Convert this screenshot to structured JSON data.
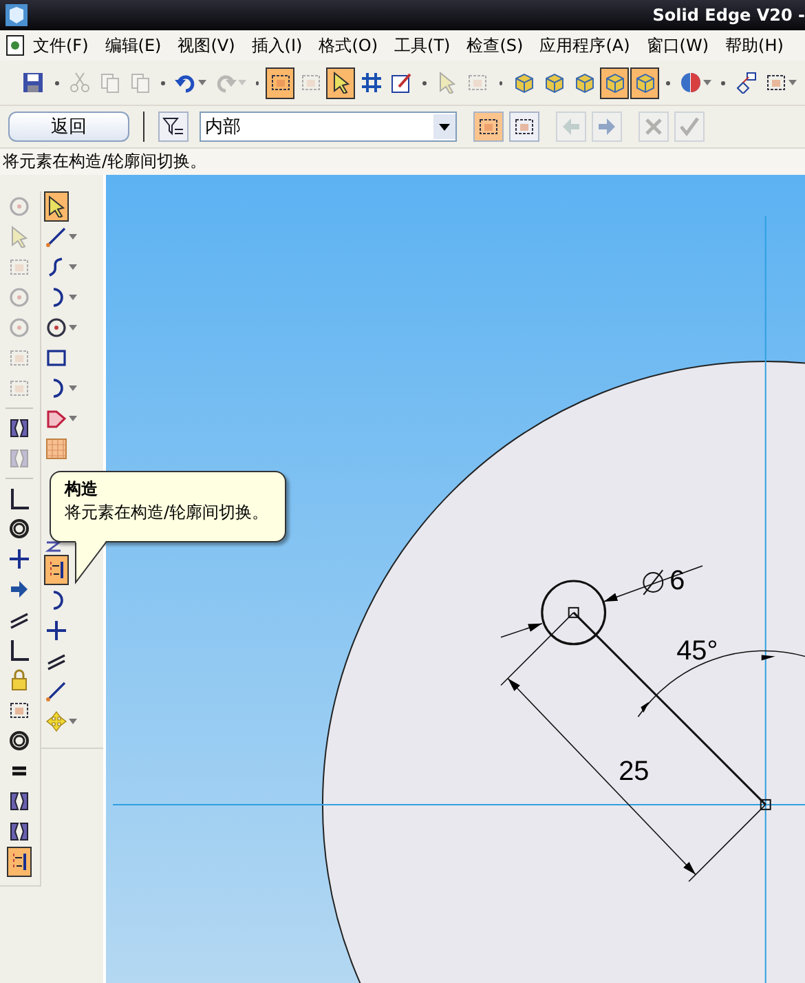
{
  "window": {
    "title": "Solid Edge V20 - "
  },
  "menu": [
    "文件(F)",
    "编辑(E)",
    "视图(V)",
    "插入(I)",
    "格式(O)",
    "工具(T)",
    "检查(S)",
    "应用程序(A)",
    "窗口(W)",
    "帮助(H)"
  ],
  "toolbar": [
    [
      {
        "kind": "save",
        "selected": false,
        "disabled": false,
        "dropdown": false
      }
    ],
    [
      {
        "kind": "cut",
        "selected": false,
        "disabled": true,
        "dropdown": false
      },
      {
        "kind": "copy",
        "selected": false,
        "disabled": true,
        "dropdown": false
      },
      {
        "kind": "paste",
        "selected": false,
        "disabled": true,
        "dropdown": false
      }
    ],
    [
      {
        "kind": "undo",
        "selected": false,
        "disabled": false,
        "dropdown": true
      },
      {
        "kind": "redo",
        "selected": false,
        "disabled": true,
        "dropdown": true
      }
    ],
    [
      {
        "kind": "frame",
        "selected": true,
        "disabled": false,
        "dropdown": false
      },
      {
        "kind": "frame",
        "selected": false,
        "disabled": true,
        "dropdown": false
      },
      {
        "kind": "pointer",
        "selected": true,
        "disabled": false,
        "dropdown": false
      },
      {
        "kind": "grid",
        "selected": false,
        "disabled": false,
        "dropdown": false
      },
      {
        "kind": "sketch",
        "selected": false,
        "disabled": false,
        "dropdown": false
      }
    ],
    [
      {
        "kind": "pointer",
        "selected": false,
        "disabled": true,
        "dropdown": false
      },
      {
        "kind": "frame",
        "selected": false,
        "disabled": true,
        "dropdown": false
      }
    ],
    [
      {
        "kind": "cube",
        "selected": false,
        "disabled": false,
        "dropdown": false
      },
      {
        "kind": "cube",
        "selected": false,
        "disabled": false,
        "dropdown": false
      },
      {
        "kind": "cube",
        "selected": false,
        "disabled": false,
        "dropdown": false
      },
      {
        "kind": "cube",
        "selected": true,
        "disabled": false,
        "dropdown": false
      },
      {
        "kind": "cube",
        "selected": true,
        "disabled": false,
        "dropdown": false
      }
    ],
    [
      {
        "kind": "sphere",
        "selected": false,
        "disabled": false,
        "dropdown": true
      }
    ],
    [
      {
        "kind": "relations",
        "selected": false,
        "disabled": false,
        "dropdown": false
      },
      {
        "kind": "frame",
        "selected": false,
        "disabled": false,
        "dropdown": true
      }
    ]
  ],
  "ribbon": {
    "back_button": "返回",
    "select_field": {
      "value": "内部"
    },
    "buttons": [
      {
        "kind": "frame",
        "selected": true,
        "disabled": false
      },
      {
        "kind": "frame",
        "selected": false,
        "disabled": false
      },
      {
        "kind": "arrow-left",
        "selected": false,
        "disabled": true
      },
      {
        "kind": "arrow-right",
        "selected": false,
        "disabled": true
      },
      {
        "kind": "close",
        "selected": false,
        "disabled": true
      },
      {
        "kind": "check",
        "selected": false,
        "disabled": true
      }
    ]
  },
  "status_text": "将元素在构造/轮廓间切换。",
  "left_toolbar_1": [
    [
      {
        "kind": "circle",
        "selected": false,
        "disabled": true
      },
      {
        "kind": "pointer",
        "selected": false,
        "disabled": true
      },
      {
        "kind": "frame",
        "selected": false,
        "disabled": true
      },
      {
        "kind": "circle",
        "selected": false,
        "disabled": true
      },
      {
        "kind": "circle",
        "selected": false,
        "disabled": true
      },
      {
        "kind": "frame",
        "selected": false,
        "disabled": true
      },
      {
        "kind": "frame",
        "selected": false,
        "disabled": true
      }
    ],
    [
      {
        "kind": "mirror",
        "selected": false,
        "disabled": false
      },
      {
        "kind": "mirror",
        "selected": false,
        "disabled": true
      }
    ],
    [
      {
        "kind": "corner",
        "selected": false,
        "disabled": false
      },
      {
        "kind": "ring",
        "selected": false,
        "disabled": false
      },
      {
        "kind": "cross",
        "selected": false,
        "disabled": false
      },
      {
        "kind": "arrow-right",
        "selected": false,
        "disabled": false
      },
      {
        "kind": "parallel",
        "selected": false,
        "disabled": false
      },
      {
        "kind": "corner",
        "selected": false,
        "disabled": false
      },
      {
        "kind": "lock",
        "selected": false,
        "disabled": false
      },
      {
        "kind": "frame",
        "selected": false,
        "disabled": false
      },
      {
        "kind": "ring",
        "selected": false,
        "disabled": false
      },
      {
        "kind": "equal",
        "selected": false,
        "disabled": false
      },
      {
        "kind": "mirror",
        "selected": false,
        "disabled": false
      },
      {
        "kind": "mirror",
        "selected": false,
        "disabled": false
      },
      {
        "kind": "construction",
        "selected": true,
        "disabled": false
      }
    ]
  ],
  "left_toolbar_2": [
    {
      "kind": "pointer",
      "selected": true,
      "dropdown": false
    },
    {
      "kind": "line",
      "selected": false,
      "dropdown": true
    },
    {
      "kind": "curve",
      "selected": false,
      "dropdown": true
    },
    {
      "kind": "arc",
      "selected": false,
      "dropdown": true
    },
    {
      "kind": "circle",
      "selected": false,
      "dropdown": true
    },
    {
      "kind": "rectangle",
      "selected": false,
      "dropdown": false
    },
    {
      "kind": "arc",
      "selected": false,
      "dropdown": true
    },
    {
      "kind": "shape",
      "selected": false,
      "dropdown": true
    },
    {
      "kind": "pattern",
      "selected": false,
      "dropdown": false
    },
    {
      "kind": "wave",
      "selected": false,
      "dropdown": false
    },
    {
      "kind": "construction",
      "selected": true,
      "dropdown": false
    },
    {
      "kind": "arc",
      "selected": false,
      "dropdown": false
    },
    {
      "kind": "cross",
      "selected": false,
      "dropdown": false
    },
    {
      "kind": "parallel",
      "selected": false,
      "dropdown": false
    },
    {
      "kind": "line",
      "selected": false,
      "dropdown": false
    },
    {
      "kind": "move",
      "selected": false,
      "dropdown": true
    }
  ],
  "tooltip": {
    "title": "构造",
    "text": "将元素在构造/轮廓间切换。"
  },
  "drawing": {
    "diameter": "6",
    "angle": "45°",
    "distance": "25"
  }
}
